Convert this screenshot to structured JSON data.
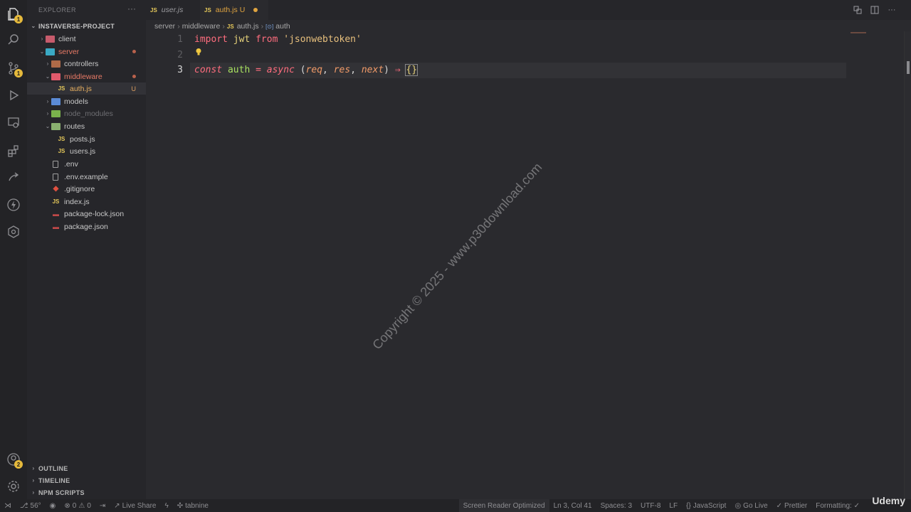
{
  "explorer": {
    "title": "EXPLORER",
    "more": "···",
    "project": "INSTAVERSE-PROJECT",
    "tree": [
      {
        "label": "client",
        "type": "folder",
        "color": "#c75b6c"
      },
      {
        "label": "server",
        "type": "folder-open",
        "color": "#3aa9c4",
        "modified": true
      },
      {
        "label": "controllers",
        "type": "folder",
        "color": "#b06b48"
      },
      {
        "label": "middleware",
        "type": "folder-open",
        "color": "#e05a6c",
        "modified": true
      },
      {
        "label": "auth.js",
        "type": "js",
        "status": "U"
      },
      {
        "label": "models",
        "type": "folder",
        "color": "#5b8bd6"
      },
      {
        "label": "node_modules",
        "type": "folder",
        "color": "#7ab24c"
      },
      {
        "label": "routes",
        "type": "folder-open",
        "color": "#8ab070"
      },
      {
        "label": "posts.js",
        "type": "js"
      },
      {
        "label": "users.js",
        "type": "js"
      },
      {
        "label": ".env",
        "type": "file"
      },
      {
        "label": ".env.example",
        "type": "file"
      },
      {
        "label": ".gitignore",
        "type": "git"
      },
      {
        "label": "index.js",
        "type": "js"
      },
      {
        "label": "package-lock.json",
        "type": "json"
      },
      {
        "label": "package.json",
        "type": "json"
      }
    ],
    "sections": [
      "OUTLINE",
      "TIMELINE",
      "NPM SCRIPTS"
    ]
  },
  "activity": {
    "explorer_badge": "1",
    "scm_badge": "1",
    "accounts_badge": "2"
  },
  "tabs": [
    {
      "label": "user.js",
      "icon": "JS",
      "active": false
    },
    {
      "label": "auth.js",
      "status": "U",
      "icon": "JS",
      "active": true
    }
  ],
  "breadcrumb": {
    "parts": [
      "server",
      "middleware"
    ],
    "file": "auth.js",
    "symbol": "auth",
    "js_icon": "JS"
  },
  "editor": {
    "lines": [
      "1",
      "2",
      "3"
    ],
    "line1": {
      "import": "import",
      "name": "jwt",
      "from": "from",
      "module": "'jsonwebtoken'"
    },
    "line3": {
      "const": "const",
      "name": "auth",
      "eq": "=",
      "async": "async",
      "open": "(",
      "p1": "req",
      "c1": ",",
      "p2": "res",
      "c2": ",",
      "p3": "next",
      "close": ")",
      "arrow": "⇒",
      "brace": "{}"
    }
  },
  "watermark": "Copyright © 2025 - www.p30download.com",
  "status": {
    "branch_icon": "⎇",
    "temp": "56°",
    "errors": "0",
    "warnings": "0",
    "live_share": "Live Share",
    "tabnine": "tabnine",
    "screen_reader": "Screen Reader Optimized",
    "position": "Ln 3, Col 41",
    "spaces": "Spaces: 3",
    "encoding": "UTF-8",
    "eol": "LF",
    "language": "JavaScript",
    "go_live": "Go Live",
    "prettier": "Prettier",
    "formatting": "Formatting: ✓",
    "brand": "Udemy"
  }
}
